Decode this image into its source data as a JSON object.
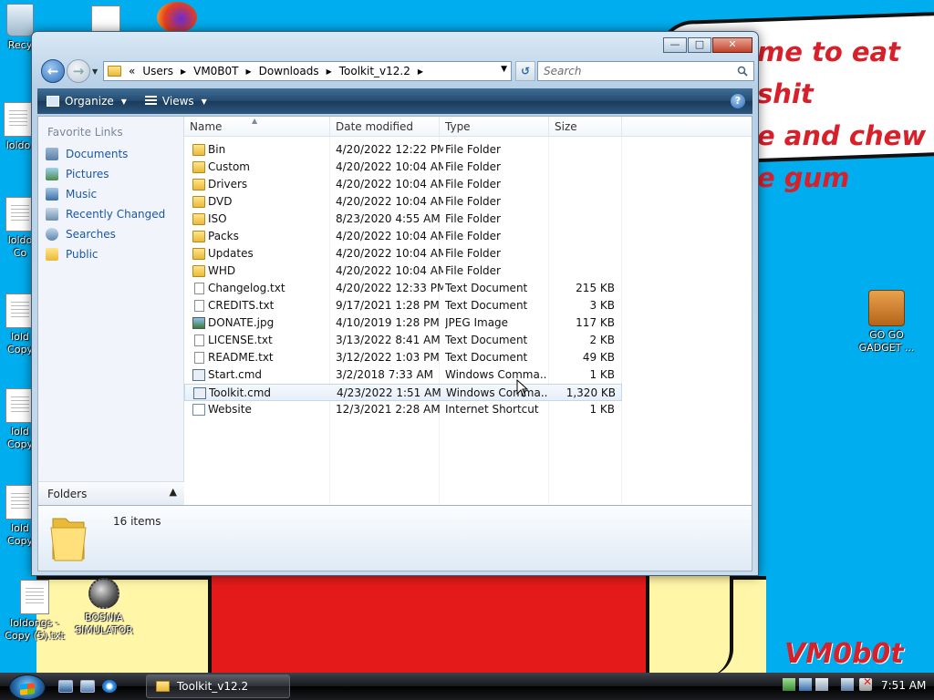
{
  "wallpaper": {
    "speech_text": "me to eat shit\ne and chew\ne gum",
    "signature": "VM0b0t"
  },
  "desktop_icons": [
    {
      "label": "Recy",
      "kind": "recycle"
    },
    {
      "label": "loldo",
      "kind": "doc"
    },
    {
      "label": "loldo\nCo",
      "kind": "doc"
    },
    {
      "label": "lold\nCopy",
      "kind": "doc"
    },
    {
      "label": "lold\nCopy",
      "kind": "doc"
    },
    {
      "label": "lold\nCopy",
      "kind": "doc"
    },
    {
      "label": "loldongs -\nCopy (5).txt",
      "kind": "doc"
    },
    {
      "label": "BOSNIA\nSIMULATOR",
      "kind": "mine"
    },
    {
      "label": "GO GO\nGADGET ...",
      "kind": "briefcase"
    }
  ],
  "window": {
    "breadcrumb": [
      "Users",
      "VM0B0T",
      "Downloads",
      "Toolkit_v12.2"
    ],
    "search_placeholder": "Search",
    "toolbar": {
      "organize": "Organize",
      "views": "Views"
    },
    "nav_pane": {
      "title": "Favorite Links",
      "links": [
        "Documents",
        "Pictures",
        "Music",
        "Recently Changed",
        "Searches",
        "Public"
      ],
      "folders_label": "Folders"
    },
    "columns": {
      "name": "Name",
      "date": "Date modified",
      "type": "Type",
      "size": "Size"
    },
    "files": [
      {
        "name": "Bin",
        "date": "4/20/2022 12:22 PM",
        "type": "File Folder",
        "size": "",
        "icon": "folder"
      },
      {
        "name": "Custom",
        "date": "4/20/2022 10:04 AM",
        "type": "File Folder",
        "size": "",
        "icon": "folder"
      },
      {
        "name": "Drivers",
        "date": "4/20/2022 10:04 AM",
        "type": "File Folder",
        "size": "",
        "icon": "folder"
      },
      {
        "name": "DVD",
        "date": "4/20/2022 10:04 AM",
        "type": "File Folder",
        "size": "",
        "icon": "folder"
      },
      {
        "name": "ISO",
        "date": "8/23/2020 4:55 AM",
        "type": "File Folder",
        "size": "",
        "icon": "folder"
      },
      {
        "name": "Packs",
        "date": "4/20/2022 10:04 AM",
        "type": "File Folder",
        "size": "",
        "icon": "folder"
      },
      {
        "name": "Updates",
        "date": "4/20/2022 10:04 AM",
        "type": "File Folder",
        "size": "",
        "icon": "folder"
      },
      {
        "name": "WHD",
        "date": "4/20/2022 10:04 AM",
        "type": "File Folder",
        "size": "",
        "icon": "folder"
      },
      {
        "name": "Changelog.txt",
        "date": "4/20/2022 12:33 PM",
        "type": "Text Document",
        "size": "215 KB",
        "icon": "doc"
      },
      {
        "name": "CREDITS.txt",
        "date": "9/17/2021 1:28 PM",
        "type": "Text Document",
        "size": "3 KB",
        "icon": "doc"
      },
      {
        "name": "DONATE.jpg",
        "date": "4/10/2019 1:28 PM",
        "type": "JPEG Image",
        "size": "117 KB",
        "icon": "img"
      },
      {
        "name": "LICENSE.txt",
        "date": "3/13/2022 8:41 AM",
        "type": "Text Document",
        "size": "2 KB",
        "icon": "doc"
      },
      {
        "name": "README.txt",
        "date": "3/12/2022 1:03 PM",
        "type": "Text Document",
        "size": "49 KB",
        "icon": "doc"
      },
      {
        "name": "Start.cmd",
        "date": "3/2/2018 7:33 AM",
        "type": "Windows Comma...",
        "size": "1 KB",
        "icon": "cmd"
      },
      {
        "name": "Toolkit.cmd",
        "date": "4/23/2022 1:51 AM",
        "type": "Windows Comma...",
        "size": "1,320 KB",
        "icon": "cmd",
        "hover": true
      },
      {
        "name": "Website",
        "date": "12/3/2021 2:28 AM",
        "type": "Internet Shortcut",
        "size": "1 KB",
        "icon": "url"
      }
    ],
    "item_count": "16 items"
  },
  "taskbar": {
    "task_label": "Toolkit_v12.2",
    "clock": "7:51 AM"
  }
}
